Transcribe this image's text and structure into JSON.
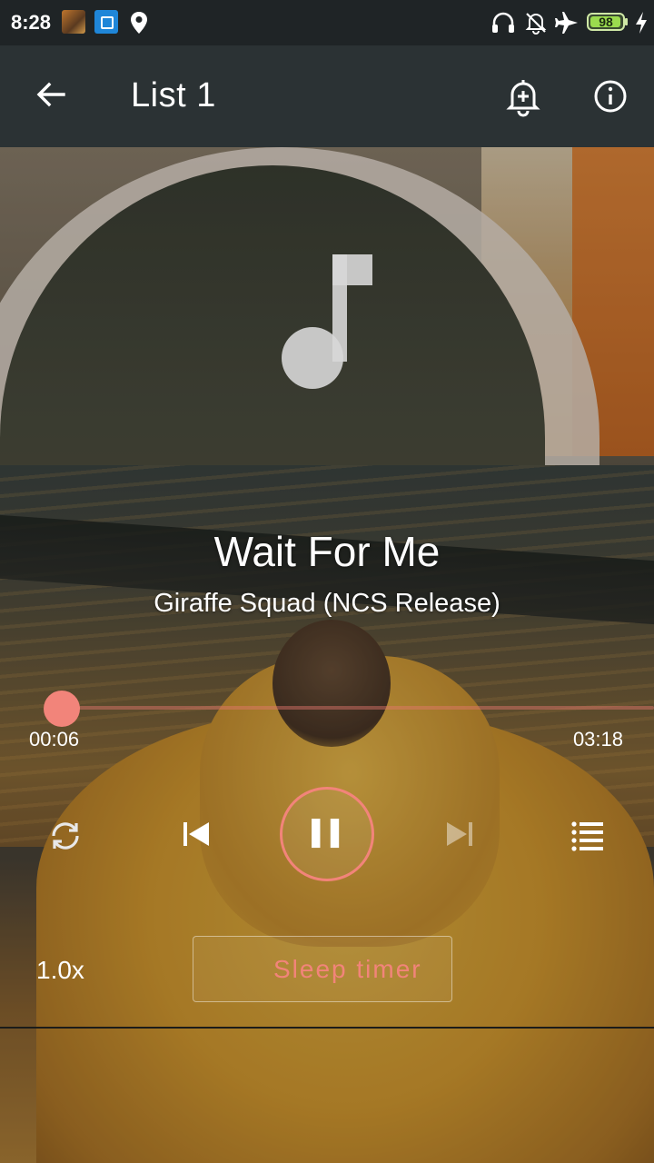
{
  "status_bar": {
    "time": "8:28",
    "battery_level": "98",
    "battery_fraction": 0.98,
    "icons": [
      "notification-thumbnail-icon",
      "mi-app-icon",
      "location-icon",
      "headset-icon",
      "silent-mode-icon",
      "airplane-mode-icon",
      "battery-icon",
      "charging-icon"
    ]
  },
  "app_bar": {
    "title": "List 1",
    "back_icon": "arrow-back-icon",
    "actions": [
      "alarm-add-icon",
      "info-icon"
    ]
  },
  "player": {
    "artwork_icon": "music-note-icon",
    "title": "Wait For Me",
    "artist": "Giraffe Squad (NCS Release)",
    "elapsed": "00:06",
    "duration": "03:18",
    "progress_fraction": 0.03,
    "controls": [
      "repeat-icon",
      "skip-previous-icon",
      "pause-icon",
      "skip-next-icon",
      "queue-list-icon"
    ],
    "speed": "1.0x",
    "sleep_timer_label": "Sleep timer",
    "accent_color": "#f2847a"
  }
}
